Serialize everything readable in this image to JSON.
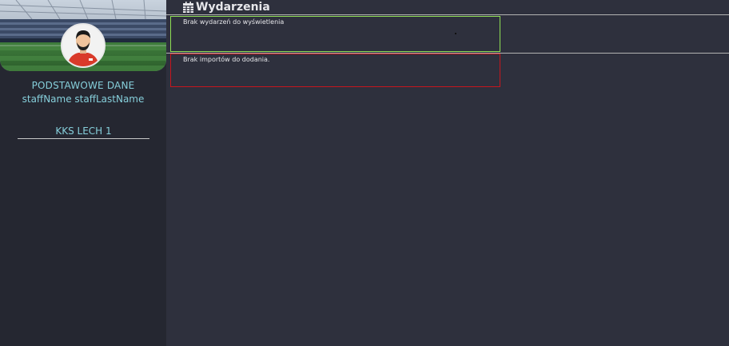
{
  "sidebar": {
    "section_title": "PODSTAWOWE DANE",
    "staff_name": "staffName staffLastName",
    "team_link": "KKS LECH 1"
  },
  "main": {
    "title": "Wydarzenia",
    "title_icon": "calendar-icon",
    "events_panel": {
      "message": "Brak wydarzeń do wyświetlenia",
      "border_color": "#8ede55"
    },
    "imports_panel": {
      "message": "Brak importów do dodania.",
      "border_color": "#c6161d"
    }
  },
  "colors": {
    "background": "#2e303d",
    "sidebar": "#252731",
    "accent_text": "#86cfdb"
  }
}
